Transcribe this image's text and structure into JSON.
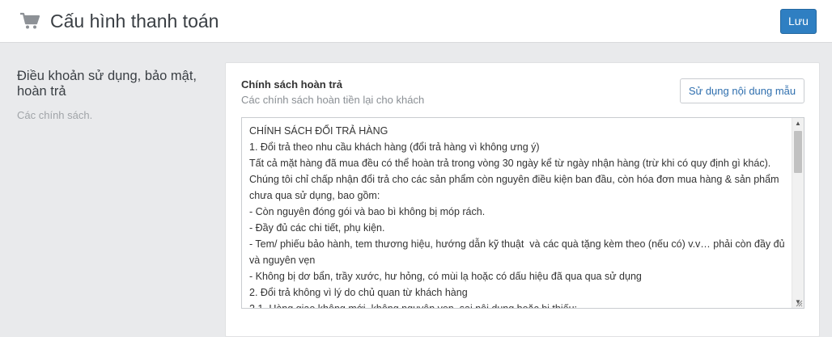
{
  "header": {
    "title": "Cấu hình thanh toán",
    "cart_icon": "cart-icon",
    "save_label": "Lưu"
  },
  "section": {
    "title": "Điều khoản sử dụng, bảo mật, hoàn trả",
    "description": "Các chính sách."
  },
  "field": {
    "label": "Chính sách hoàn trả",
    "help": "Các chính sách hoàn tiền lại cho khách",
    "template_button": "Sử dụng nội dung mẫu",
    "value": "CHÍNH SÁCH ĐỔI TRẢ HÀNG\n1. Đổi trả theo nhu cầu khách hàng (đổi trả hàng vì không ưng ý)\nTất cả mặt hàng đã mua đều có thể hoàn trả trong vòng 30 ngày kể từ ngày nhận hàng (trừ khi có quy định gì khác). Chúng tôi chỉ chấp nhận đổi trả cho các sản phẩm còn nguyên điều kiện ban đầu, còn hóa đơn mua hàng & sản phẩm chưa qua sử dụng, bao gồm:\n- Còn nguyên đóng gói và bao bì không bị móp rách.\n- Đầy đủ các chi tiết, phụ kiện.\n- Tem/ phiếu bảo hành, tem thương hiệu, hướng dẫn kỹ thuật  và các quà tặng kèm theo (nếu có) v.v… phải còn đầy đủ và nguyên vẹn\n- Không bị dơ bẩn, trầy xước, hư hỏng, có mùi lạ hoặc có dấu hiệu đã qua qua sử dụng\n2. Đổi trả không vì lý do chủ quan từ khách hàng\n2.1. Hàng giao không mới, không nguyên vẹn, sai nội dung hoặc bị thiếu:"
  },
  "colors": {
    "primary": "#2f7fc2",
    "background": "#e9eaec",
    "link": "#2f6fae"
  }
}
